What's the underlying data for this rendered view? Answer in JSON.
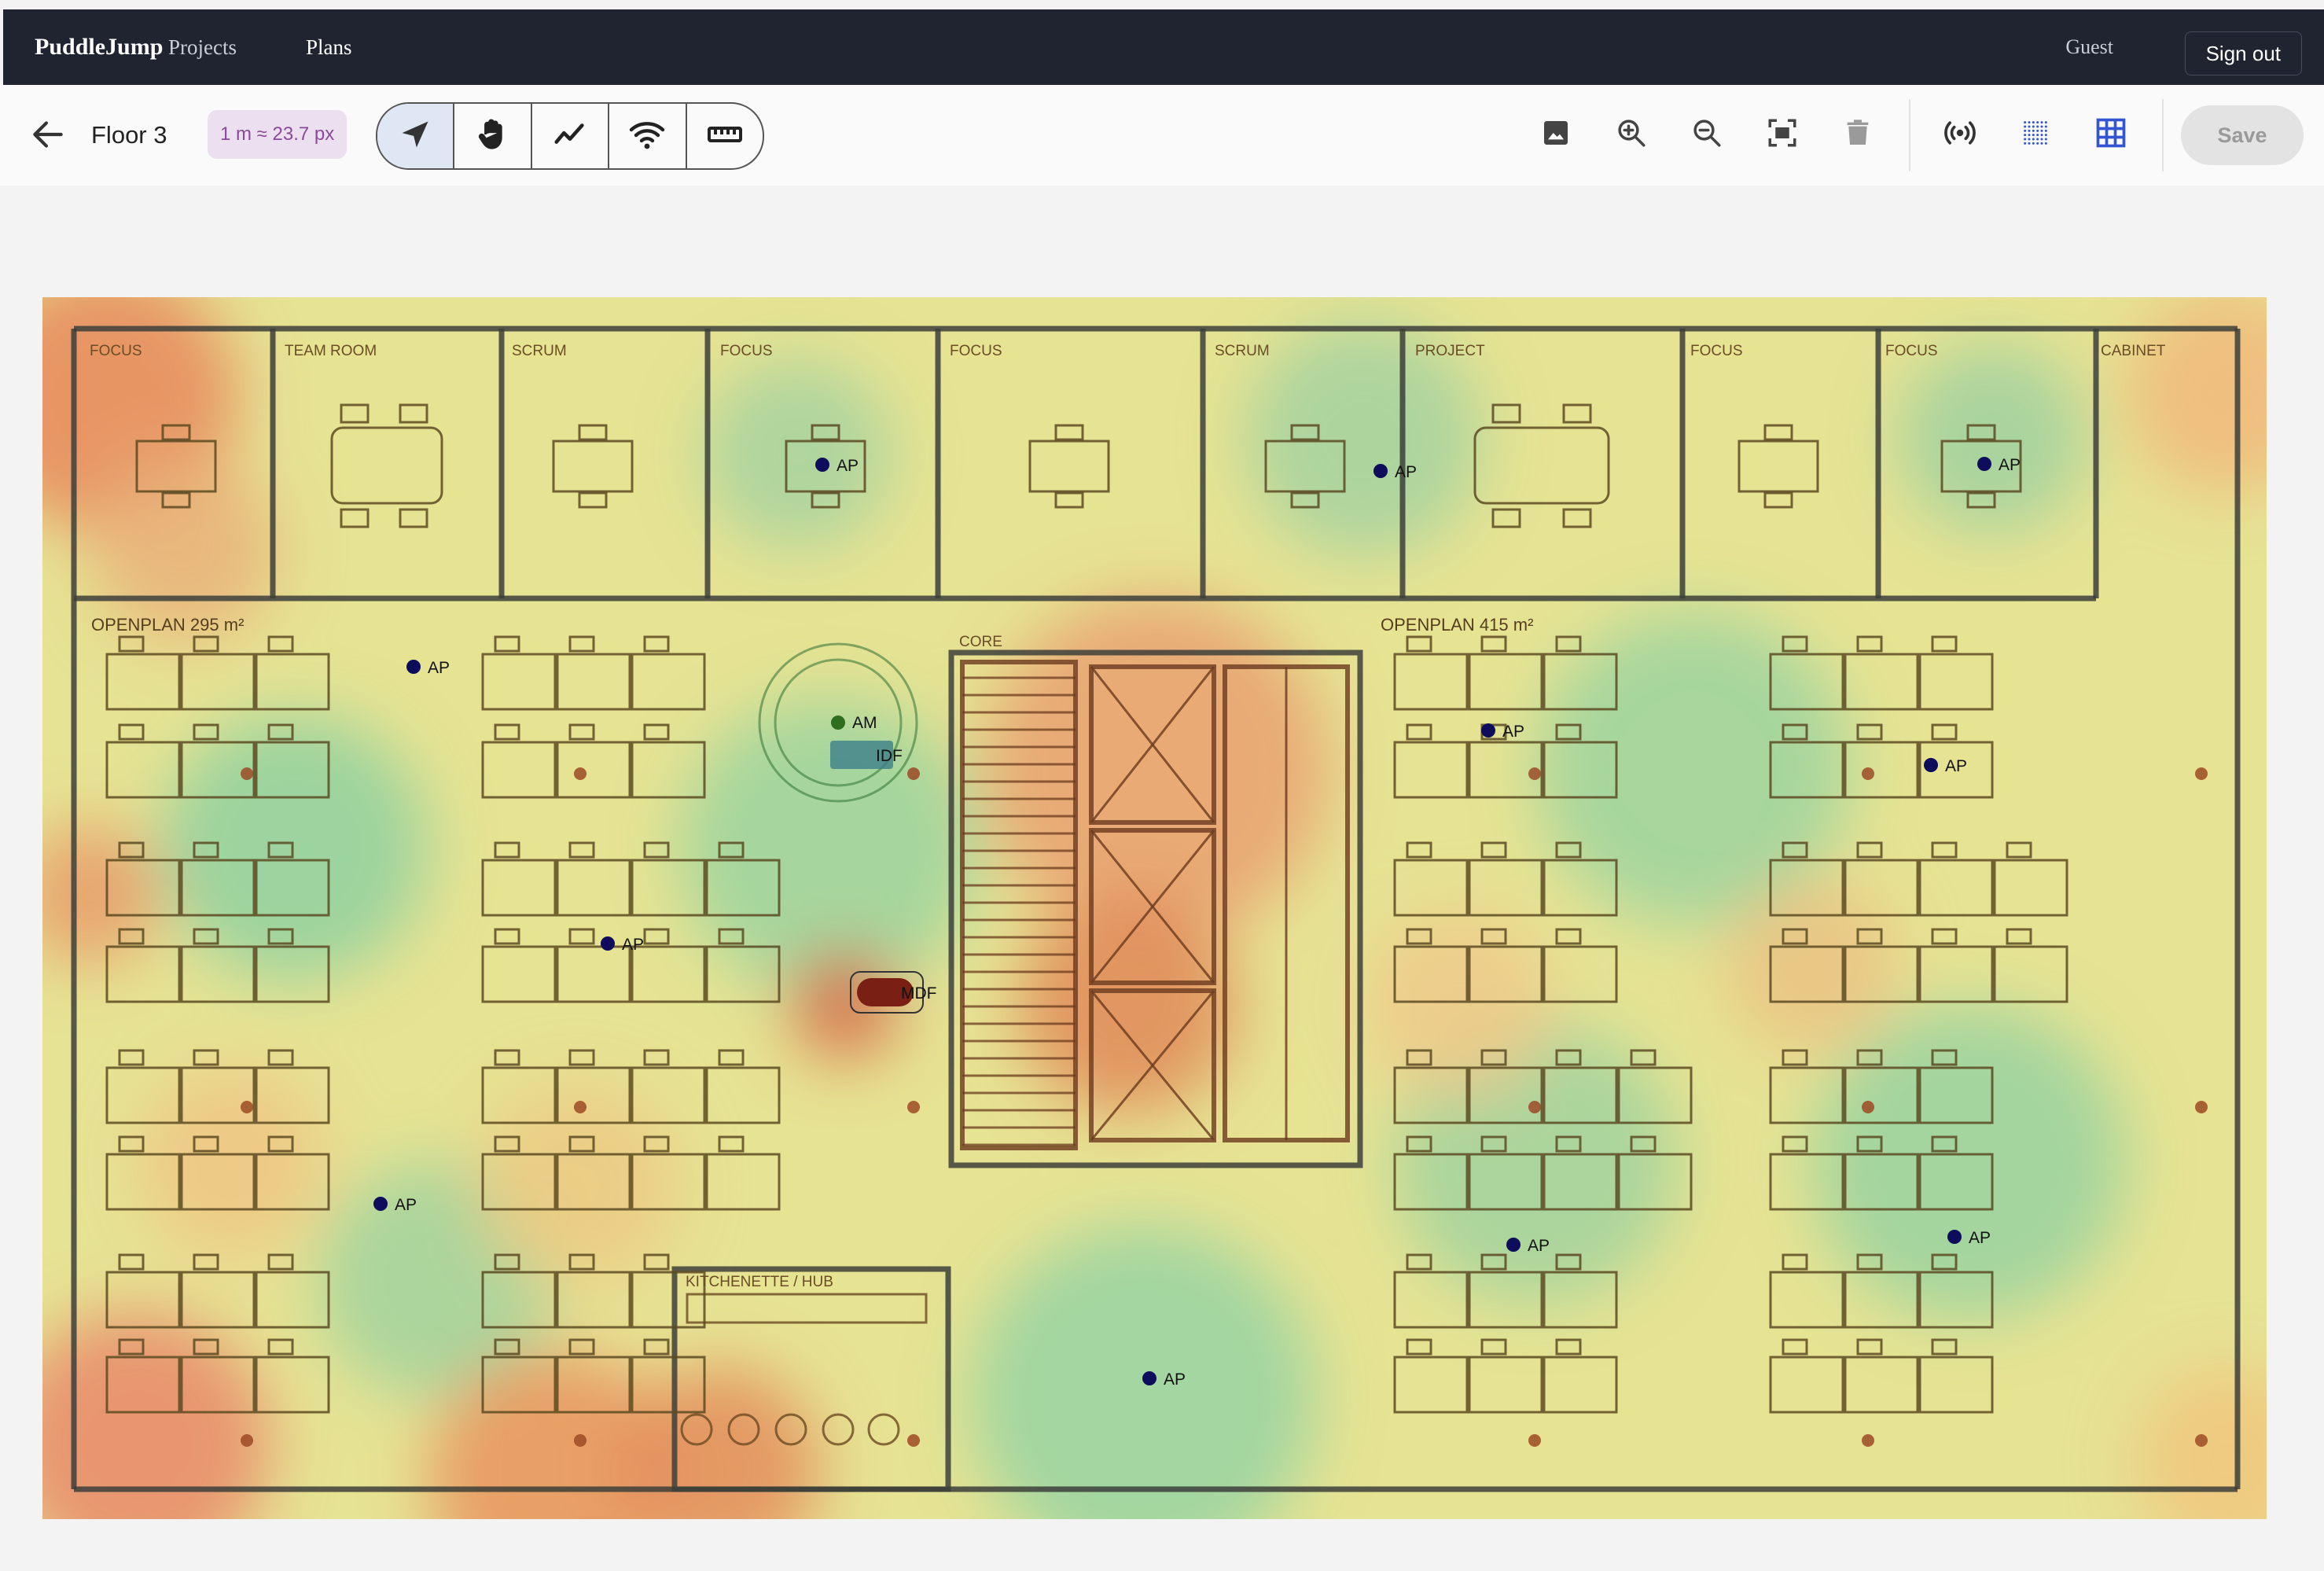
{
  "header": {
    "brand": "PuddleJump",
    "nav": [
      "Projects",
      "Plans"
    ],
    "user": "Guest",
    "signout_label": "Sign out"
  },
  "toolbar": {
    "floor_title": "Floor 3",
    "scale": "1 m ≈ 23.7 px",
    "save_label": "Save",
    "tools": [
      "select-icon",
      "pan-hand-icon",
      "draw-wall-icon",
      "wifi-icon",
      "ruler-icon"
    ],
    "actions": [
      "image-icon",
      "zoom-in-icon",
      "zoom-out-icon",
      "fit-screen-icon",
      "trash-icon",
      "broadcast-icon",
      "dot-grid-icon",
      "grid-icon"
    ]
  },
  "colors": {
    "header_bg": "#1f2430",
    "ap_dot": "#0d0d5c",
    "am_dot": "#2d6e1f",
    "mdf": "#7a1f14",
    "wall": "#3d3f3a",
    "grid_active": "#3455d1"
  },
  "plan": {
    "rooms": [
      "FOCUS",
      "TEAM ROOM",
      "SCRUM",
      "FOCUS",
      "FOCUS",
      "SCRUM",
      "PROJECT",
      "FOCUS",
      "FOCUS",
      "CABINET"
    ],
    "zones": {
      "openplan_left": "OPENPLAN 295 m²",
      "openplan_right": "OPENPLAN 415 m²",
      "core": "CORE",
      "kitchen": "KITCHENETTE / HUB"
    },
    "devices": {
      "ap": "AP",
      "am": "AM",
      "idf": "IDF",
      "mdf": "MDF"
    }
  }
}
